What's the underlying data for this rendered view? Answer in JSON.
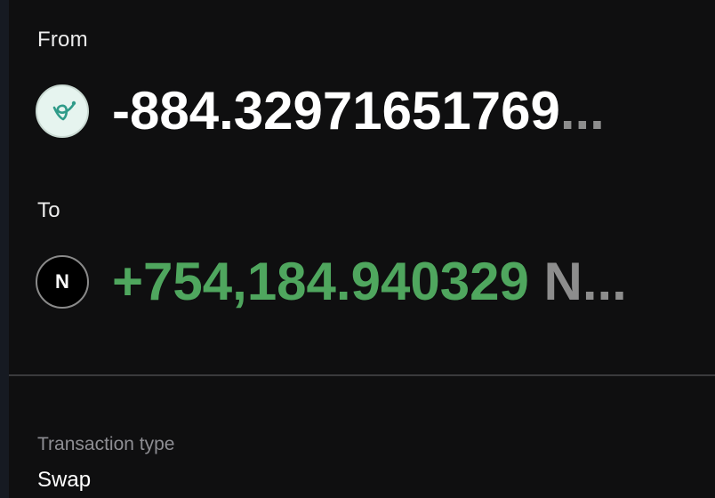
{
  "transfer": {
    "from_label": "From",
    "from_amount": "-884.32971651769",
    "from_overflow": "...",
    "from_icon": "leaf-token-icon",
    "to_label": "To",
    "to_amount": "+754,184.940329",
    "to_symbol_truncated": "N...",
    "to_icon_letter": "N"
  },
  "details": {
    "transaction_type_label": "Transaction type",
    "transaction_type_value": "Swap"
  },
  "colors": {
    "background": "#0f0f10",
    "positive": "#4fa65e",
    "muted": "#8d8d8d",
    "divider": "#3a3a3c"
  }
}
